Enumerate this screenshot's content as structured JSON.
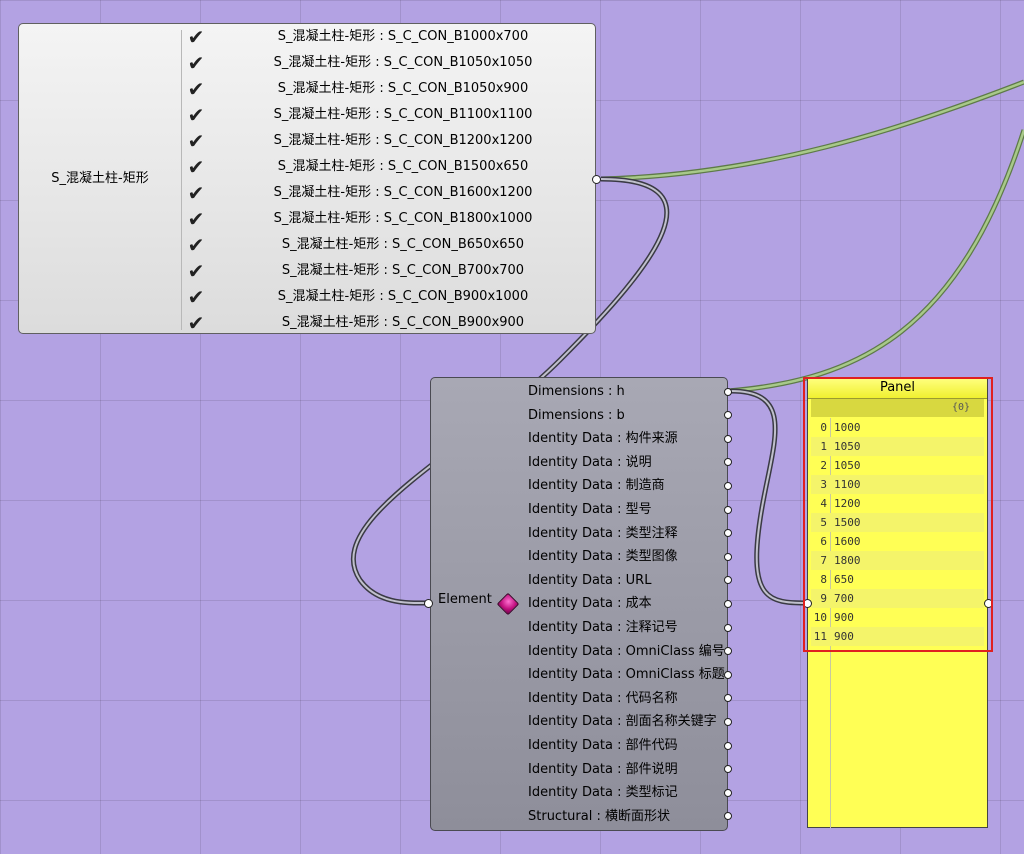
{
  "value_list": {
    "name": "S_混凝土柱-矩形",
    "check_glyph": "✔",
    "items": [
      "S_混凝土柱-矩形 : S_C_CON_B1000x700",
      "S_混凝土柱-矩形 : S_C_CON_B1050x1050",
      "S_混凝土柱-矩形 : S_C_CON_B1050x900",
      "S_混凝土柱-矩形 : S_C_CON_B1100x1100",
      "S_混凝土柱-矩形 : S_C_CON_B1200x1200",
      "S_混凝土柱-矩形 : S_C_CON_B1500x650",
      "S_混凝土柱-矩形 : S_C_CON_B1600x1200",
      "S_混凝土柱-矩形 : S_C_CON_B1800x1000",
      "S_混凝土柱-矩形 : S_C_CON_B650x650",
      "S_混凝土柱-矩形 : S_C_CON_B700x700",
      "S_混凝土柱-矩形 : S_C_CON_B900x1000",
      "S_混凝土柱-矩形 : S_C_CON_B900x900"
    ]
  },
  "component": {
    "input_label": "Element",
    "icon": "element-cube-icon",
    "outputs": [
      "Dimensions : h",
      "Dimensions : b",
      "Identity Data : 构件来源",
      "Identity Data : 说明",
      "Identity Data : 制造商",
      "Identity Data : 型号",
      "Identity Data : 类型注释",
      "Identity Data : 类型图像",
      "Identity Data : URL",
      "Identity Data : 成本",
      "Identity Data : 注释记号",
      "Identity Data : OmniClass 编号",
      "Identity Data : OmniClass 标题",
      "Identity Data : 代码名称",
      "Identity Data : 剖面名称关键字",
      "Identity Data : 部件代码",
      "Identity Data : 部件说明",
      "Identity Data : 类型标记",
      "Structural : 横断面形状"
    ]
  },
  "panel": {
    "title": "Panel",
    "path": "{0}",
    "rows": [
      {
        "index": "0",
        "value": "1000"
      },
      {
        "index": "1",
        "value": "1050"
      },
      {
        "index": "2",
        "value": "1050"
      },
      {
        "index": "3",
        "value": "1100"
      },
      {
        "index": "4",
        "value": "1200"
      },
      {
        "index": "5",
        "value": "1500"
      },
      {
        "index": "6",
        "value": "1600"
      },
      {
        "index": "7",
        "value": "1800"
      },
      {
        "index": "8",
        "value": "650"
      },
      {
        "index": "9",
        "value": "700"
      },
      {
        "index": "10",
        "value": "900"
      },
      {
        "index": "11",
        "value": "900"
      }
    ]
  },
  "colors": {
    "canvas": "#b3a2e3",
    "panel": "#ffff55",
    "highlight": "#e02020",
    "selected_wire": "#9ab878"
  }
}
